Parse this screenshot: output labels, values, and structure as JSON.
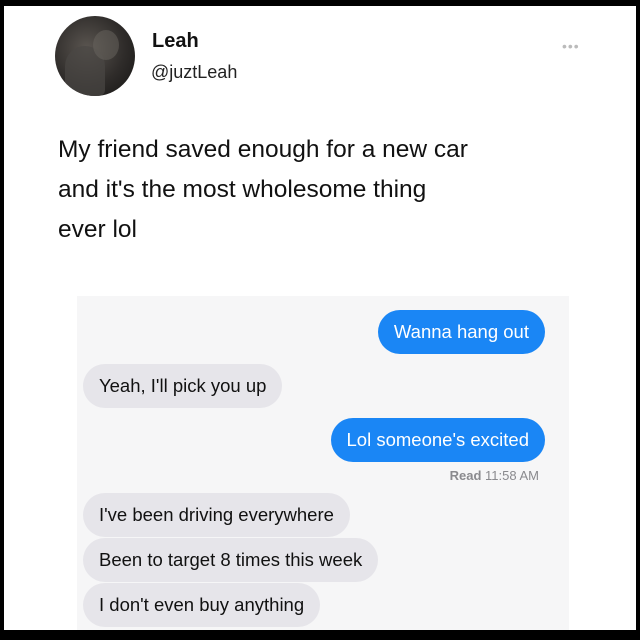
{
  "post": {
    "author_name": "Leah",
    "author_handle": "@juztLeah",
    "more_icon": "more-dots-icon",
    "text_lines": [
      "My friend saved enough for a new car",
      "and it's the most wholesome thing",
      "ever lol"
    ]
  },
  "chat": {
    "messages": [
      {
        "side": "sent",
        "text": "Wanna hang out"
      },
      {
        "side": "received",
        "text": "Yeah, I'll pick you up"
      },
      {
        "side": "sent",
        "text": "Lol someone's excited"
      },
      {
        "side": "received",
        "text": "I've been driving everywhere"
      },
      {
        "side": "received",
        "text": "Been to target 8 times this week"
      },
      {
        "side": "received",
        "text": "I don't even buy anything"
      }
    ],
    "read_label": "Read",
    "read_time": "11:58 AM"
  },
  "colors": {
    "sent_bubble": "#1a86f5",
    "received_bubble": "#e6e5ea",
    "chat_background": "#f6f6f7"
  }
}
